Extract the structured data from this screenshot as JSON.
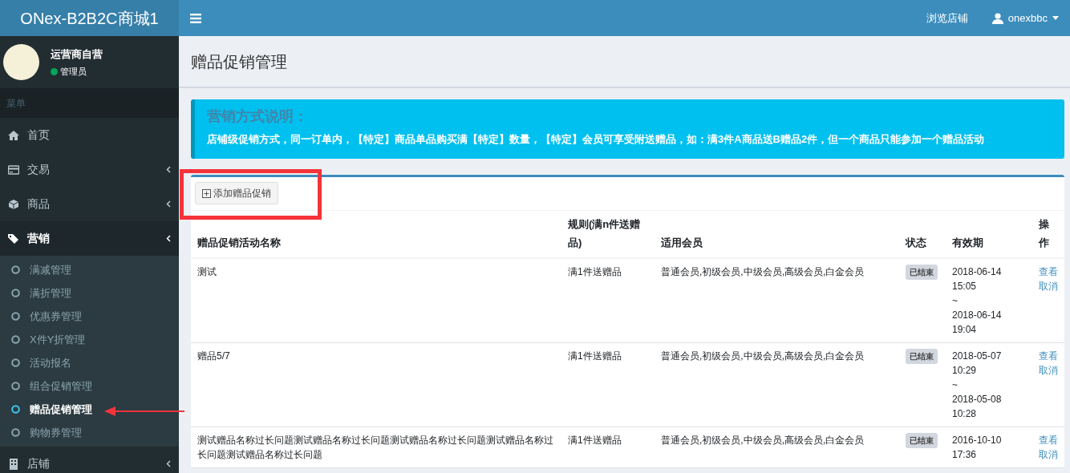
{
  "brand": "ONex-B2B2C商城1",
  "navbar": {
    "links": [
      {
        "label": "浏览店铺"
      }
    ],
    "user": {
      "label": "onexbbc"
    }
  },
  "user_panel": {
    "name": "运营商自营",
    "role": "管理员",
    "online": true
  },
  "sidebar": {
    "header": "菜单",
    "items": [
      {
        "label": "首页"
      },
      {
        "label": "交易",
        "expanded": false
      },
      {
        "label": "商品",
        "expanded": false
      },
      {
        "label": "营销",
        "expanded": true,
        "children": [
          {
            "label": "满减管理",
            "selected": false
          },
          {
            "label": "满折管理",
            "selected": false
          },
          {
            "label": "优惠券管理",
            "selected": false
          },
          {
            "label": "X件Y折管理",
            "selected": false
          },
          {
            "label": "活动报名",
            "selected": false
          },
          {
            "label": "组合促销管理",
            "selected": false
          },
          {
            "label": "赠品促销管理",
            "selected": true
          },
          {
            "label": "购物券管理",
            "selected": false
          }
        ]
      },
      {
        "label": "店铺",
        "expanded": false
      }
    ]
  },
  "page_title": "赠品促销管理",
  "callout": {
    "title": "营销方式说明：",
    "text": "店铺级促销方式，同一订单内，【特定】商品单品购买满【特定】数量，【特定】会员可享受附送赠品，如：满3件A商品送B赠品2件，但一个商品只能参加一个赠品活动"
  },
  "add_button": {
    "label": "添加赠品促销"
  },
  "table": {
    "columns": [
      "赠品促销活动名称",
      "规则(满n件送赠品)",
      "适用会员",
      "状态",
      "有效期",
      "操作"
    ],
    "rows": [
      {
        "name": "测试",
        "rule": "满1件送赠品",
        "members": "普通会员,初级会员,中级会员,高级会员,白金会员",
        "status": "已结束",
        "start": [
          "2018-06-14",
          "15:05"
        ],
        "separator": "~",
        "end": [
          "2018-06-14",
          "19:04"
        ],
        "actions": [
          "查看",
          "取消"
        ]
      },
      {
        "name": "赠品5/7",
        "rule": "满1件送赠品",
        "members": "普通会员,初级会员,中级会员,高级会员,白金会员",
        "status": "已结束",
        "start": [
          "2018-05-07",
          "10:29"
        ],
        "separator": "~",
        "end": [
          "2018-05-08",
          "10:28"
        ],
        "actions": [
          "查看",
          "取消"
        ]
      },
      {
        "name": "测试赠品名称过长问题测试赠品名称过长问题测试赠品名称过长问题测试赠品名称过长问题测试赠品名称过长问题",
        "rule": "满1件送赠品",
        "members": "普通会员,初级会员,中级会员,高级会员,白金会员",
        "status": "已结束",
        "start": [
          "2016-10-10",
          "17:36"
        ],
        "actions": [
          "查看",
          "取消"
        ]
      }
    ]
  }
}
